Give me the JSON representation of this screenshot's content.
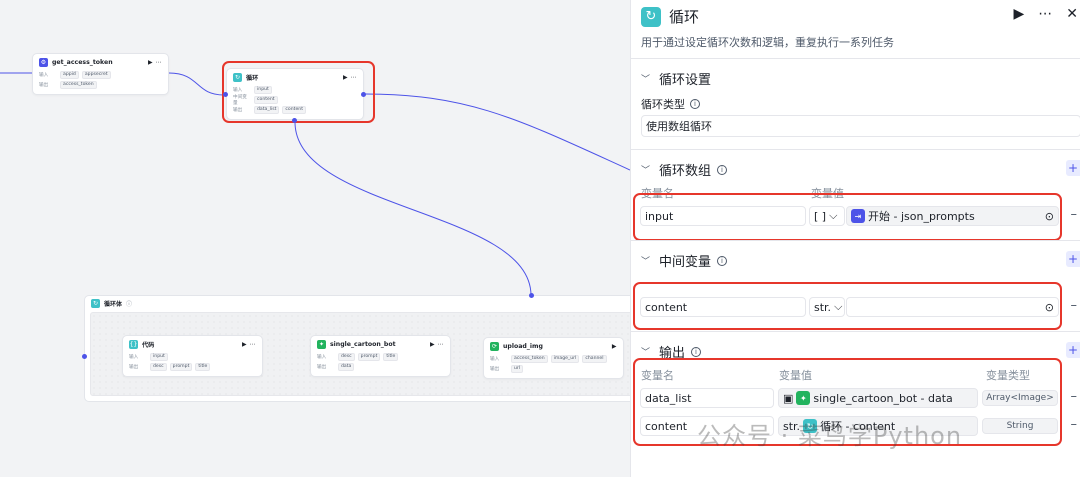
{
  "canvas": {
    "node_token": {
      "title": "get_access_token",
      "input_label": "输入",
      "inputs": [
        "appid",
        "appsecret"
      ],
      "output_label": "输出",
      "outputs": [
        "access_token"
      ]
    },
    "node_loop": {
      "title": "循环",
      "input_label": "输入",
      "inputs": [
        "input"
      ],
      "mid_label": "中间变量",
      "mids": [
        "content"
      ],
      "output_label": "输出",
      "outputs": [
        "data_list",
        "content"
      ]
    },
    "loop_body": {
      "title": "循环体"
    },
    "node_code": {
      "title": "代码",
      "input_label": "输入",
      "inputs": [
        "input"
      ],
      "output_label": "输出",
      "outputs": [
        "desc",
        "prompt",
        "title"
      ]
    },
    "node_bot": {
      "title": "single_cartoon_bot",
      "input_label": "输入",
      "inputs": [
        "desc",
        "prompt",
        "title"
      ],
      "output_label": "输出",
      "outputs": [
        "data"
      ]
    },
    "node_upload": {
      "title": "upload_img",
      "input_label": "输入",
      "inputs": [
        "access_token",
        "image_url",
        "channel"
      ],
      "output_label": "输出",
      "outputs": [
        "url"
      ]
    }
  },
  "panel": {
    "title": "循环",
    "description": "用于通过设定循环次数和逻辑，重复执行一系列任务",
    "section_settings": "循环设置",
    "loop_type_label": "循环类型",
    "loop_type_value": "使用数组循环",
    "section_array": "循环数组",
    "col_var_name": "变量名",
    "col_var_value": "变量值",
    "array_row": {
      "name": "input",
      "type": "[ ]",
      "ref": "开始 - json_prompts"
    },
    "section_mid": "中间变量",
    "mid_row": {
      "name": "content",
      "type": "str."
    },
    "section_output": "输出",
    "col_var_type": "变量类型",
    "out_rows": [
      {
        "name": "data_list",
        "ref": "single_cartoon_bot - data",
        "type": "Array<Image>"
      },
      {
        "name": "content",
        "prefix": "str.",
        "ref": "循环 - content",
        "type": "String"
      }
    ]
  },
  "watermark": "公众号 · 菜鸟学Python"
}
